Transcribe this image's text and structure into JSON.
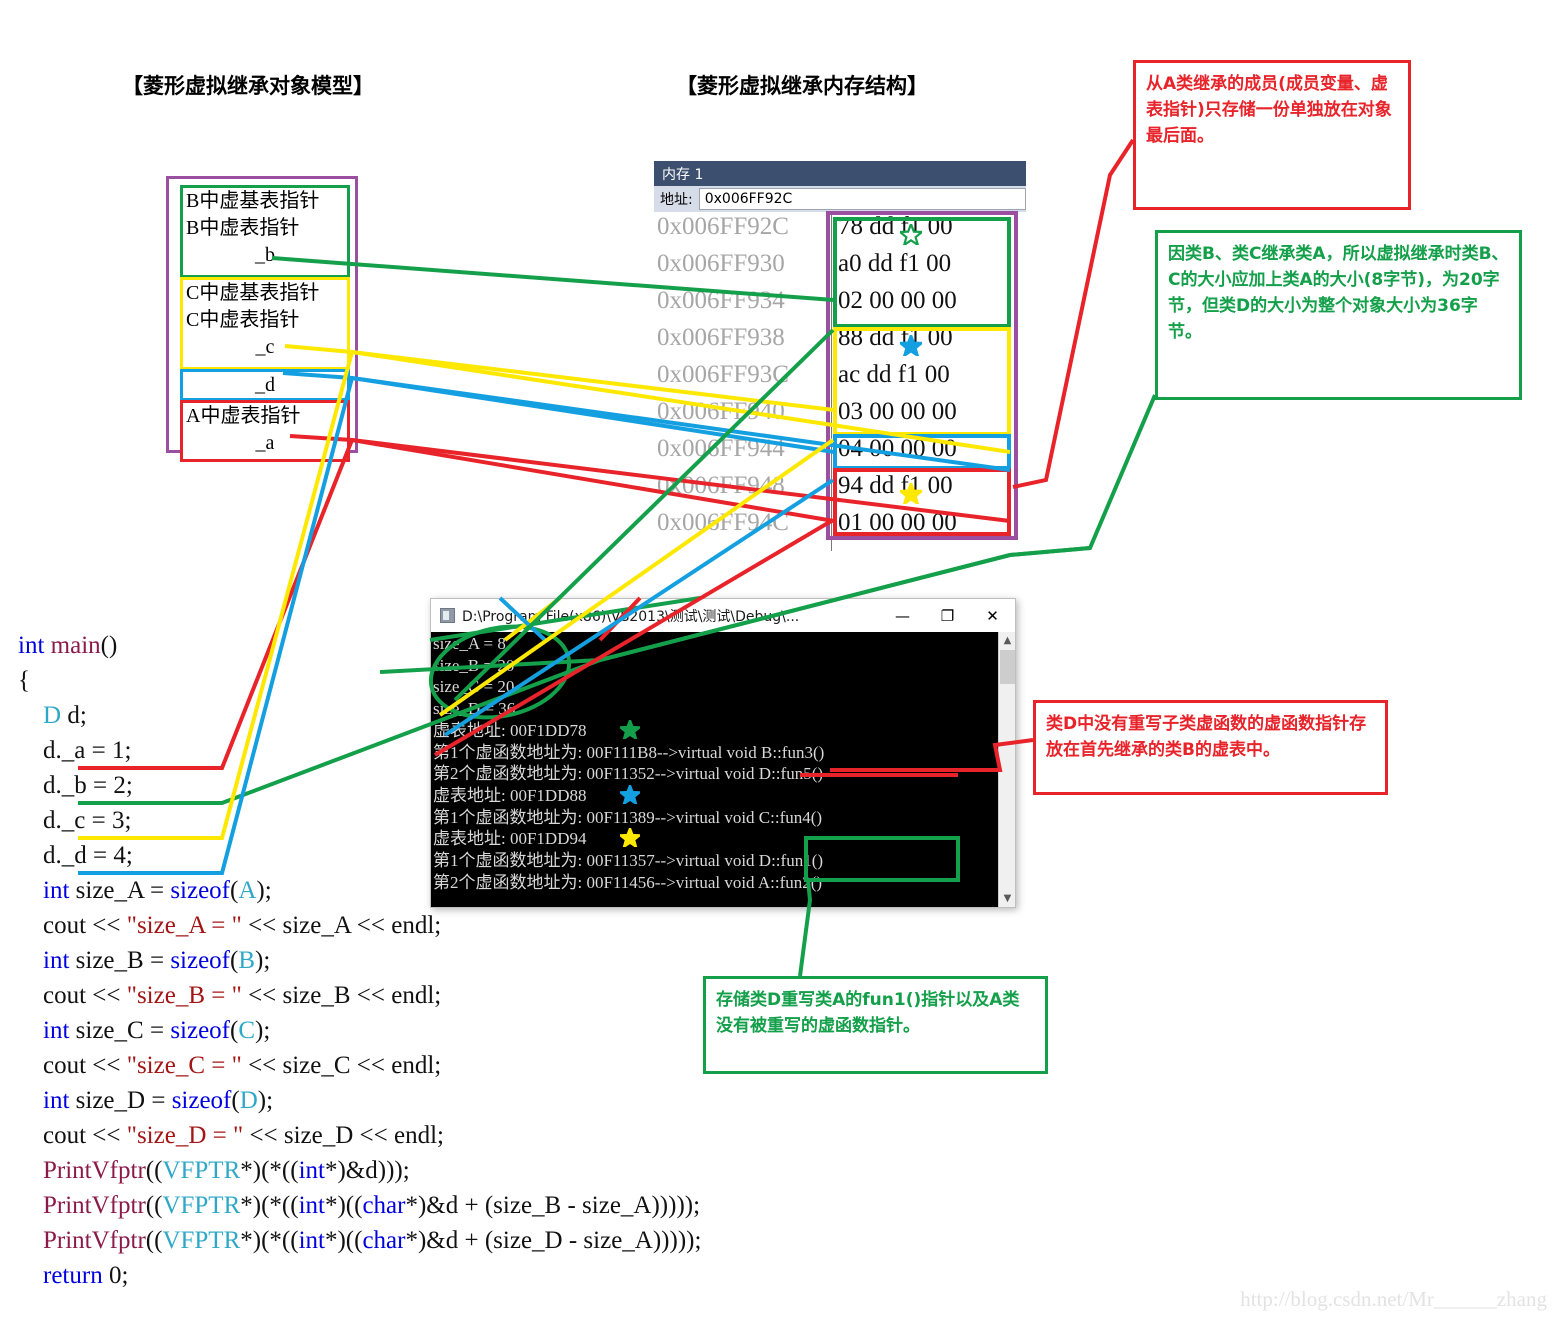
{
  "headings": {
    "left": "【菱形虚拟继承对象模型】",
    "right": "【菱形虚拟继承内存结构】"
  },
  "object_model": {
    "b_block": {
      "line1": "B中虚基表指针",
      "line2": "B中虚表指针",
      "line3": "_b",
      "color": "#14a04a"
    },
    "c_block": {
      "line1": "C中虚基表指针",
      "line2": "C中虚表指针",
      "line3": "_c",
      "color": "#ffe800"
    },
    "d_block": {
      "line1": "_d",
      "color": "#14a0e0"
    },
    "a_block": {
      "line1": "A中虚表指针",
      "line2": "_a",
      "color": "#e8232a"
    },
    "outer_color": "#9b4fa0"
  },
  "memory_window": {
    "title": "内存 1",
    "address_label": "地址:",
    "address_value": "0x006FF92C",
    "rows": [
      {
        "address": "0x006FF92C",
        "bytes": "78  dd  f1  00"
      },
      {
        "address": "0x006FF930",
        "bytes": "a0  dd  f1  00"
      },
      {
        "address": "0x006FF934",
        "bytes": "02  00  00  00"
      },
      {
        "address": "0x006FF938",
        "bytes": "88  dd  f1  00"
      },
      {
        "address": "0x006FF93C",
        "bytes": "ac  dd  f1  00"
      },
      {
        "address": "0x006FF940",
        "bytes": "03  00  00  00"
      },
      {
        "address": "0x006FF944",
        "bytes": "04  00  00  00"
      },
      {
        "address": "0x006FF948",
        "bytes": "94  dd  f1  00"
      },
      {
        "address": "0x006FF94C",
        "bytes": "01  00  00  00"
      }
    ],
    "stars": [
      {
        "row": 0,
        "color": "#14a04a",
        "name": "green-star"
      },
      {
        "row": 3,
        "color": "#14a0e0",
        "name": "blue-star"
      },
      {
        "row": 7,
        "color": "#ffe800",
        "name": "yellow-star"
      }
    ]
  },
  "notes": {
    "note1": "从A类继承的成员(成员变量、虚表指针)只存储一份单独放在对象最后面。",
    "note2": "因类B、类C继承类A，所以虚拟继承时类B、C的大小应加上类A的大小(8字节)，为20字节，但类D的大小为整个对象大小为36字节。",
    "note3": "类D中没有重写子类虚函数的虚函数指针存放在首先继承的类B的虚表中。",
    "note4": "存储类D重写类A的fun1()指针以及A类没有被重写的虚函数指针。"
  },
  "console": {
    "title": "D:\\Program File(x86)\\VS2013\\测试\\测试\\Debug\\...",
    "minimize_label": "—",
    "maximize_label": "❐",
    "close_label": "✕",
    "lines": [
      "size_A = 8",
      "size_B = 20",
      "size_C = 20",
      "size_D = 36",
      "虚表地址: 00F1DD78",
      "第1个虚函数地址为: 00F111B8-->virtual void B::fun3()",
      "第2个虚函数地址为: 00F11352-->virtual void D::fun5()",
      "虚表地址: 00F1DD88",
      "第1个虚函数地址为: 00F11389-->virtual void C::fun4()",
      "虚表地址: 00F1DD94",
      "第1个虚函数地址为: 00F11357-->virtual void D::fun1()",
      "第2个虚函数地址为: 00F11456-->virtual void A::fun2()"
    ]
  },
  "code": {
    "lines": [
      "int main()",
      "{",
      "    D d;",
      "    d._a = 1;",
      "    d._b = 2;",
      "    d._c = 3;",
      "    d._d = 4;",
      "    int size_A = sizeof(A);",
      "    cout << \"size_A = \" << size_A << endl;",
      "    int size_B = sizeof(B);",
      "    cout << \"size_B = \" << size_B << endl;",
      "    int size_C = sizeof(C);",
      "    cout << \"size_C = \" << size_C << endl;",
      "    int size_D = sizeof(D);",
      "    cout << \"size_D = \" << size_D << endl;",
      "    PrintVfptr((VFPTR*)(*((int*)&d)));",
      "    PrintVfptr((VFPTR*)(*((int*)((char*)&d + (size_B - size_A)))));",
      "    PrintVfptr((VFPTR*)(*((int*)((char*)&d + (size_D - size_A)))));",
      "    return 0;"
    ]
  },
  "watermark": "http://blog.csdn.net/Mr______zhang",
  "colors": {
    "green": "#14a04a",
    "yellow": "#ffe800",
    "blue": "#14a0e0",
    "red": "#e8232a",
    "purple": "#9b4fa0"
  }
}
